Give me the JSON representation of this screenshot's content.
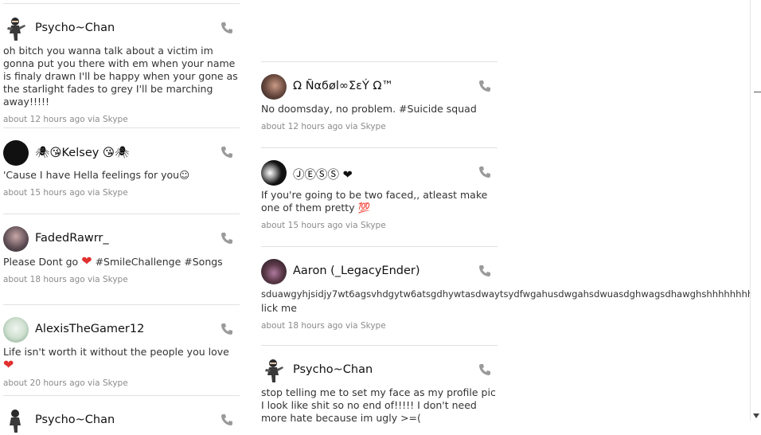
{
  "left_feed": [
    {
      "name": "Psycho~Chan",
      "text": "oh bitch you wanna talk about a victim im gonna put you there with em when your name is finaly drawn I'll be happy when your gone as the starlight fades to grey I'll be marching away!!!!!",
      "meta": "about 12 hours ago via Skype",
      "avatar": "ninja-avatar"
    },
    {
      "name": "🕷😘Kelsey 😘🕷",
      "text": "'Cause I have Hella feelings for you☺",
      "meta": "about 15 hours ago via Skype",
      "avatar": "dark-avatar"
    },
    {
      "name": "FadedRawrr_",
      "text": "Please Dont go",
      "hashtags": "#SmileChallenge #Songs",
      "meta": "about 18 hours ago via Skype",
      "avatar": "photo-avatar"
    },
    {
      "name": "AlexisTheGamer12",
      "text": "Life isn't worth it without the people you love",
      "meta": "about 20 hours ago via Skype",
      "avatar": "photo-avatar"
    },
    {
      "name": "Psycho~Chan",
      "avatar": "ninja-avatar"
    }
  ],
  "right_feed": [
    {
      "name": "Ω Ñαϭøl∞ΣεÝ Ω™",
      "text": "No doomsday, no problem. #Suicide squad",
      "meta": "about 12 hours ago via Skype",
      "avatar": "photo-avatar"
    },
    {
      "name": "ⒿⒺⓈⓈ ❤",
      "text": "If you're going to be two faced,, atleast make one of them pretty 💯",
      "meta": "about 15 hours ago via Skype",
      "avatar": "photo-avatar"
    },
    {
      "name": "Aaron (_LegacyEnder)",
      "text": "sduawgyhjsidjy7wt6agsvhdgytw6atsgdhywtasdwaytsydfwgahusdwgahsdwuasdghwagsdhawghshhhhhhhhh",
      "text2": "lick me",
      "meta": "about 18 hours ago via Skype",
      "avatar": "photo-avatar"
    },
    {
      "name": "Psycho~Chan",
      "text": "stop telling me to set my face as my profile pic I look like shit so no end of!!!!! I don't need more hate because im ugly >=(",
      "avatar": "ninja-avatar"
    }
  ]
}
